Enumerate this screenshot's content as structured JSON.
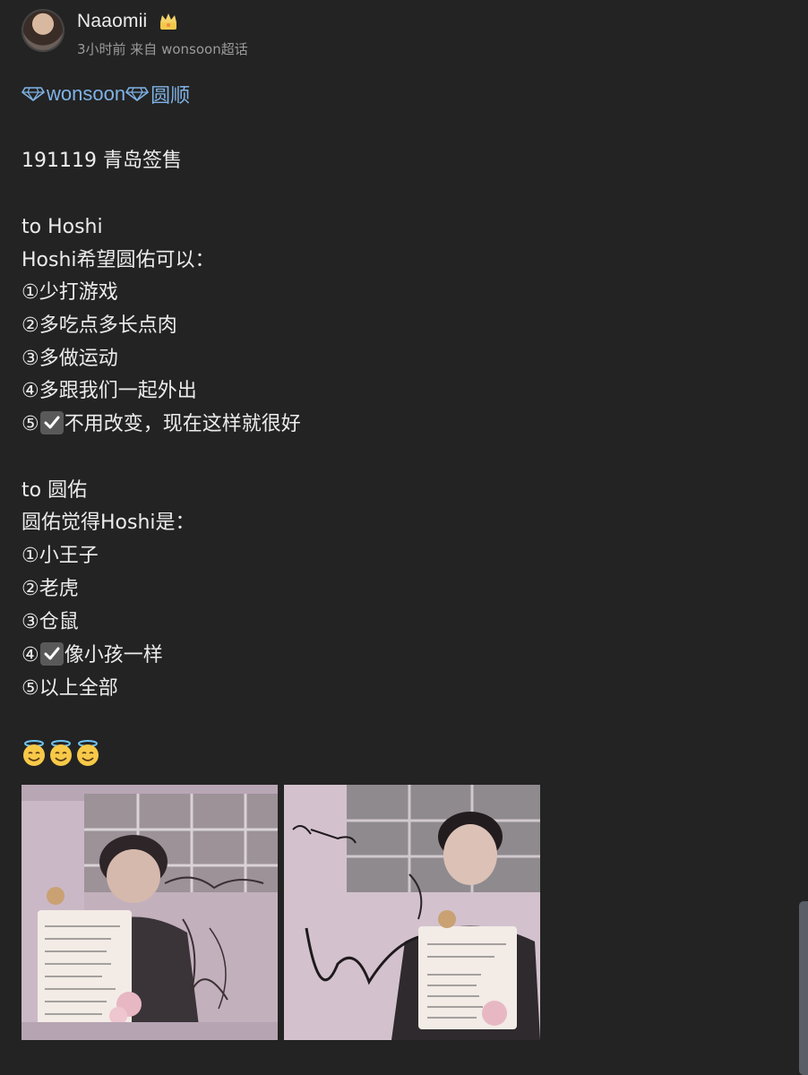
{
  "post": {
    "username": "Naaomii",
    "meta": "3小时前 来自 wonsoon超话",
    "topic": {
      "name": "wonsoon",
      "suffix": "圆顺"
    },
    "lines": [
      "191119 青岛签售",
      "to Hoshi",
      "Hoshi希望圆佑可以：",
      "①少打游戏",
      "②多吃点多长点肉",
      "③多做运动",
      "④多跟我们一起外出",
      "to 圆佑",
      "圆佑觉得Hoshi是：",
      "①小王子",
      "②老虎",
      "③仓鼠",
      "⑤以上全部"
    ],
    "checked_lines": {
      "hoshi_5_prefix": "⑤",
      "hoshi_5_text": "不用改变，现在这样就很好",
      "wonwoo_4_prefix": "④",
      "wonwoo_4_text": "像小孩一样"
    },
    "images": [
      {
        "signature": "To.Naomii",
        "note_title": "Hoshi 가 Wonwoo 가 이러면 좋겠다 :",
        "note_items": [
          "1. 게임 줄이기",
          "2. 많이 먹고 살찌기",
          "3. 운동 많이 하기",
          "4. 멤버들이랑 밖에 와 놀기",
          "5. 아무것도 안 바꾸고 지금처럼 유지하기"
        ]
      },
      {
        "signature": "To. Naomiv",
        "note_title": "Wonwoo가 생각하는 호시는 ___이다",
        "note_items": [
          "1. 어린 왕자",
          "2. 호랑이",
          "3. 햄스터",
          "4. 아이 같다",
          "5. 이상 모두"
        ]
      }
    ]
  },
  "icons": {
    "crown": "crown-icon",
    "diamond": "diamond-icon",
    "check": "check-mark-icon",
    "halo": "smiling-face-with-halo-icon"
  },
  "colors": {
    "background": "#232323",
    "text": "#ececec",
    "meta": "#9a9a9a",
    "topic_link": "#7fb3e6"
  }
}
